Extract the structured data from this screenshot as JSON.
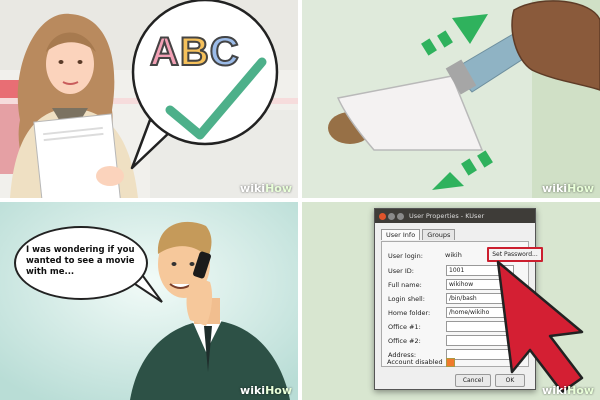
{
  "watermark": {
    "wiki": "wiki",
    "how": "How"
  },
  "panel1": {
    "abc_text": "ABC"
  },
  "panel3": {
    "bubble_text": "I was wondering if you wanted to see a movie with me..."
  },
  "panel4": {
    "window_title": "User Properties - KUser",
    "tabs": [
      {
        "label": "User Info"
      },
      {
        "label": "Groups"
      }
    ],
    "rows": [
      {
        "label": "User login:",
        "value": "wikih"
      },
      {
        "label": "User ID:",
        "value": "1001"
      },
      {
        "label": "Full name:",
        "value": "wikihow"
      },
      {
        "label": "Login shell:",
        "value": "/bin/bash"
      },
      {
        "label": "Home folder:",
        "value": "/home/wikiho"
      },
      {
        "label": "Office #1:",
        "value": ""
      },
      {
        "label": "Office #2:",
        "value": ""
      },
      {
        "label": "Address:",
        "value": ""
      },
      {
        "label": "Account disabled",
        "value": ""
      }
    ],
    "set_password_label": "Set Password...",
    "cancel_label": "Cancel",
    "ok_label": "OK",
    "accent_color": "#cc1f2f"
  }
}
